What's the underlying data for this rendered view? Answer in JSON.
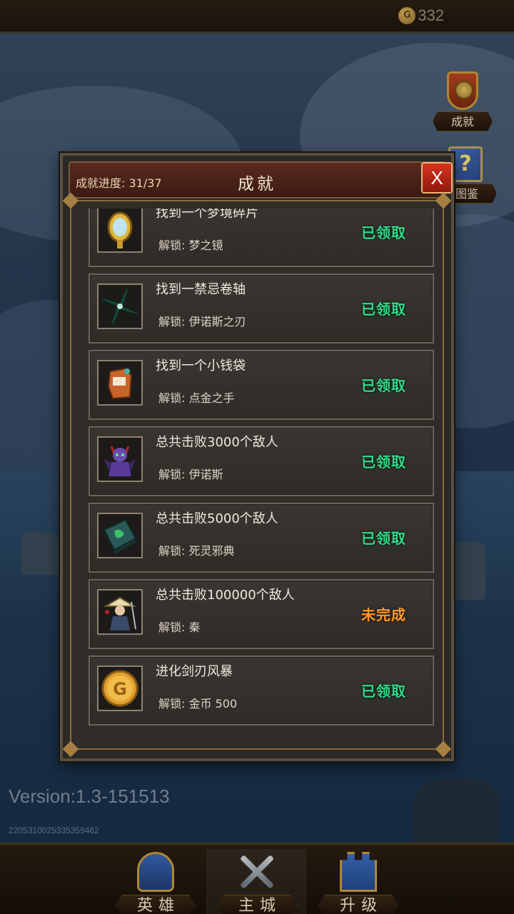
{
  "topbar": {
    "gold_symbol": "G",
    "gold_amount": "332"
  },
  "side_buttons": [
    {
      "label": "成就",
      "icon": "medal-icon"
    },
    {
      "label": "图鉴",
      "icon": "book-icon",
      "icon_text": "?"
    }
  ],
  "modal": {
    "progress_label": "成就进度: 31/37",
    "title": "成就",
    "close_label": "X",
    "unlock_prefix": "解锁:",
    "items": [
      {
        "title": "找到一个梦境碎片",
        "unlock": "梦之镜",
        "status": "已领取",
        "completed": true,
        "icon": "mirror-icon"
      },
      {
        "title": "找到一禁忌卷轴",
        "unlock": "伊诺斯之刃",
        "status": "已领取",
        "completed": true,
        "icon": "shuriken-icon"
      },
      {
        "title": "找到一个小钱袋",
        "unlock": "点金之手",
        "status": "已领取",
        "completed": true,
        "icon": "gauntlet-icon"
      },
      {
        "title": "总共击败3000个敌人",
        "unlock": "伊诺斯",
        "status": "已领取",
        "completed": true,
        "icon": "demon-hero-icon"
      },
      {
        "title": "总共击败5000个敌人",
        "unlock": "死灵邪典",
        "status": "已领取",
        "completed": true,
        "icon": "necronomicon-icon"
      },
      {
        "title": "总共击败100000个敌人",
        "unlock": "秦",
        "status": "未完成",
        "completed": false,
        "icon": "samurai-hero-icon"
      },
      {
        "title": "进化剑刃风暴",
        "unlock": "金币 500",
        "status": "已领取",
        "completed": true,
        "icon": "gold-coin-icon",
        "icon_text": "G"
      }
    ]
  },
  "version": "Version:1.3-151513",
  "build_id": "220531002533535946​2",
  "bottom_nav": [
    {
      "label": "英雄",
      "icon": "hero-helmet-icon"
    },
    {
      "label": "主城",
      "icon": "crossed-swords-icon"
    },
    {
      "label": "升级",
      "icon": "castle-upgrade-icon"
    }
  ],
  "colors": {
    "claimed": "#35d98a",
    "incomplete": "#ff9b2e",
    "header_bg": "#5a2a1e",
    "close_button": "#d8331f"
  }
}
